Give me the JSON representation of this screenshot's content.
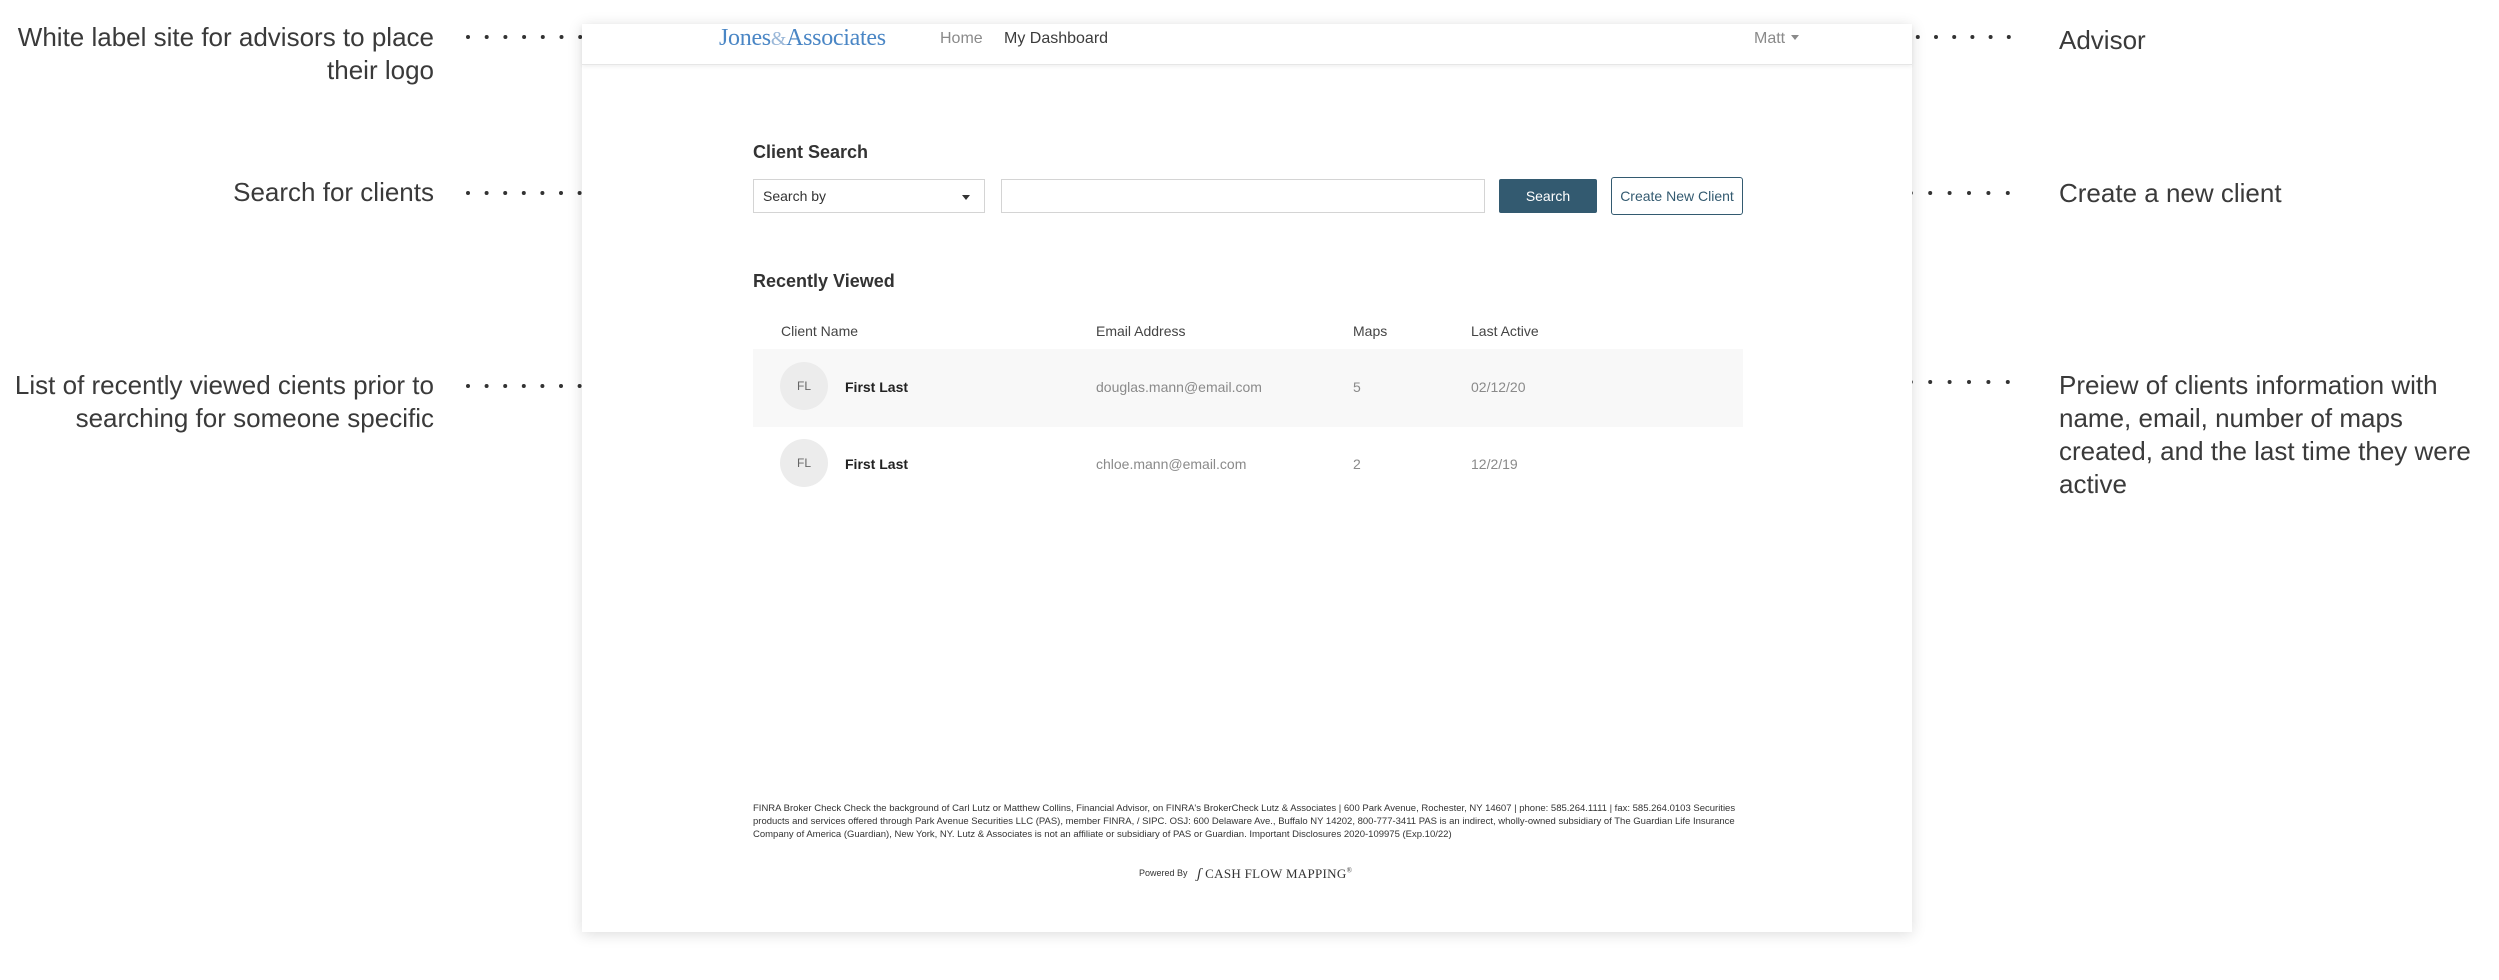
{
  "annotations": {
    "logo_note": "White label site for advisors to place their logo",
    "search_note": "Search for clients",
    "recent_note": "List of recently viewed cients prior to searching for someone specific",
    "advisor_note": "Advisor",
    "create_note": "Create a new client",
    "preview_note": "Preiew of clients information with name, email, number of maps created, and the last time they were active"
  },
  "header": {
    "logo_left": "Jones",
    "logo_amp": "&",
    "logo_right": "Associates",
    "nav": {
      "home": "Home",
      "dashboard": "My Dashboard"
    },
    "user": "Matt"
  },
  "search": {
    "title": "Client Search",
    "select_label": "Search by",
    "input_placeholder": "",
    "search_button": "Search",
    "create_button": "Create New Client"
  },
  "recent": {
    "title": "Recently Viewed",
    "columns": {
      "name": "Client Name",
      "email": "Email Address",
      "maps": "Maps",
      "last_active": "Last Active"
    },
    "rows": [
      {
        "initials": "FL",
        "name": "First Last",
        "email": "douglas.mann@email.com",
        "maps": "5",
        "last_active": "02/12/20"
      },
      {
        "initials": "FL",
        "name": "First Last",
        "email": "chloe.mann@email.com",
        "maps": "2",
        "last_active": "12/2/19"
      }
    ]
  },
  "footer": {
    "disclosure": "FINRA Broker Check Check the background of Carl Lutz or Matthew Collins, Financial Advisor, on FINRA's BrokerCheck Lutz & Associates | 600 Park Avenue, Rochester, NY 14607 | phone: 585.264.1111 | fax: 585.264.0103 Securities products and services offered through Park Avenue Securities LLC (PAS), member FINRA, / SIPC. OSJ: 600 Delaware Ave., Buffalo NY 14202, 800-777-3411 PAS is an indirect, wholly-owned subsidiary of The Guardian Life Insurance Company of America (Guardian), New York, NY. Lutz & Associates is not an affiliate or subsidiary of PAS or Guardian. Important Disclosures 2020-109975 (Exp.10/22)",
    "powered_by": "Powered By",
    "brand": "CASH FLOW MAPPING",
    "brand_mark": "®"
  }
}
